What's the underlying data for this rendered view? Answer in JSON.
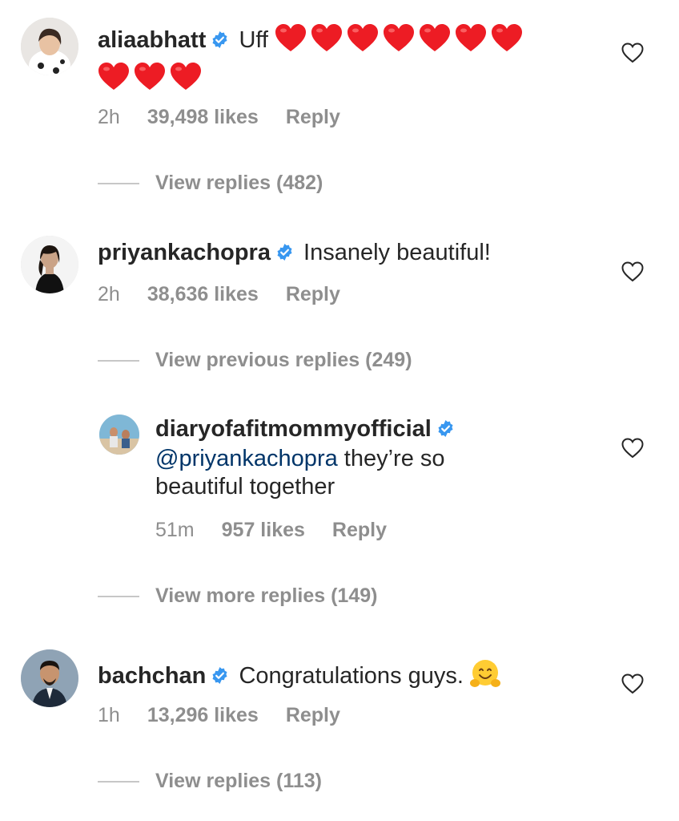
{
  "comments": [
    {
      "username": "aliaabhatt",
      "text": "Uff",
      "hearts": 10,
      "time": "2h",
      "likes": "39,498 likes",
      "reply_label": "Reply",
      "view_replies": "View replies (482)"
    },
    {
      "username": "priyankachopra",
      "text": "Insanely beautiful!",
      "time": "2h",
      "likes": "38,636 likes",
      "reply_label": "Reply",
      "view_replies": "View previous replies (249)",
      "reply": {
        "username": "diaryofafitmommyofficial",
        "mention": "@priyankachopra",
        "text": "they’re so beautiful together",
        "text_line1": "they’re so",
        "text_line2": "beautiful together",
        "time": "51m",
        "likes": "957 likes",
        "reply_label": "Reply"
      },
      "view_more_replies": "View more replies (149)"
    },
    {
      "username": "bachchan",
      "text": "Congratulations guys.",
      "emoji": "hugging-face",
      "time": "1h",
      "likes": "13,296 likes",
      "reply_label": "Reply",
      "view_replies": "View replies (113)"
    }
  ],
  "colors": {
    "text": "#262626",
    "meta": "#8e8e8e",
    "verified": "#3897f0",
    "mention": "#003569",
    "heart": "#ed1c24"
  },
  "icons": {
    "verified": "verified-badge-icon",
    "like": "heart-outline-icon"
  }
}
